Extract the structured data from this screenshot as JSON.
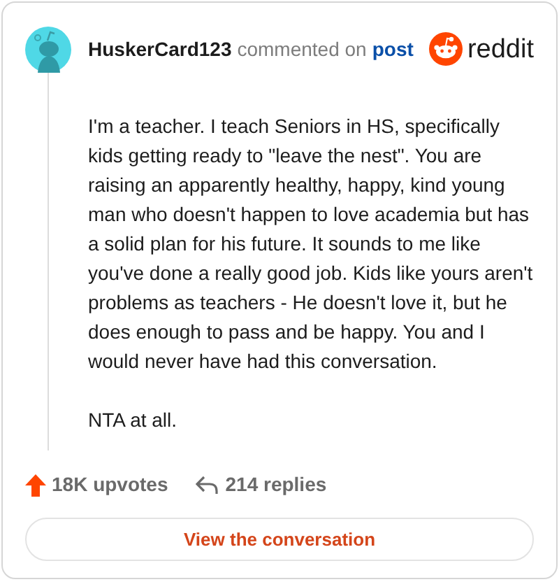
{
  "comment": {
    "author": "HuskerCard123",
    "action": "commented on",
    "link": "post"
  },
  "brand": {
    "wordmark": "reddit"
  },
  "body": [
    "I'm a teacher. I teach Seniors in HS, specifically kids getting ready to \"leave the nest\". You are raising an apparently healthy, happy, kind young man who doesn't happen to love academia but has a solid plan for his future. It sounds to me like you've done a really good job. Kids like yours aren't problems as teachers - He doesn't love it, but he does enough to pass and be happy. You and I would never have had this conversation.",
    "NTA at all."
  ],
  "footer": {
    "upvotes": "18K upvotes",
    "replies": "214 replies"
  },
  "button": "View the conversation"
}
